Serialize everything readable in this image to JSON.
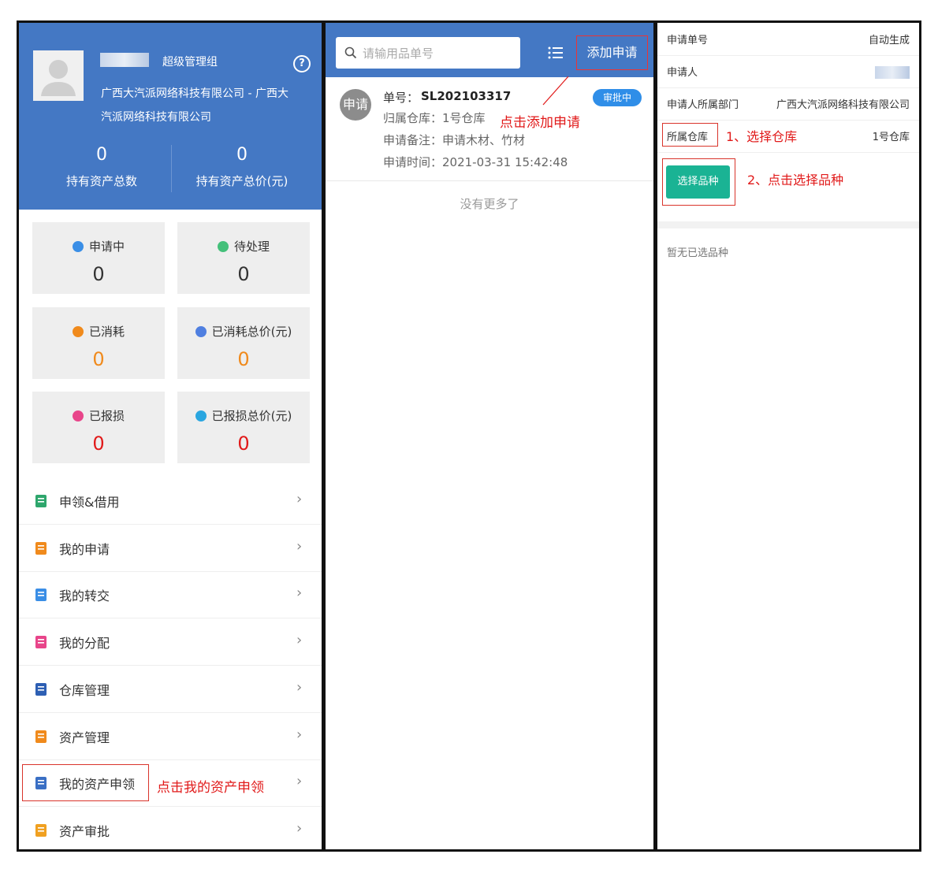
{
  "panel1": {
    "user_group": "超级管理组",
    "company": "广西大汽派网络科技有限公司 - 广西大汽派网络科技有限公司",
    "company_line1": "广西大汽派网络科技有限公司 - 广西大",
    "company_line2": "汽派网络科技有限公司",
    "help_icon": "?",
    "stats": [
      {
        "value": "0",
        "label": "持有资产总数"
      },
      {
        "value": "0",
        "label": "持有资产总价(元)"
      }
    ],
    "cards": [
      {
        "label": "申请中",
        "value": "0",
        "icon": "keyboard-icon",
        "color": "#333333",
        "icon_color": "#3a8ee6"
      },
      {
        "label": "待处理",
        "value": "0",
        "icon": "user-clock-icon",
        "color": "#333333",
        "icon_color": "#44c07a"
      },
      {
        "label": "已消耗",
        "value": "0",
        "icon": "search-circle-icon",
        "color": "#f08a1c",
        "icon_color": "#f08a1c"
      },
      {
        "label": "已消耗总价(元)",
        "value": "0",
        "icon": "money-bag-icon",
        "color": "#f08a1c",
        "icon_color": "#4f7fe0"
      },
      {
        "label": "已报损",
        "value": "0",
        "icon": "broken-icon",
        "color": "#e11a1a",
        "icon_color": "#e8458a"
      },
      {
        "label": "已报损总价(元)",
        "value": "0",
        "icon": "coins-icon",
        "color": "#e11a1a",
        "icon_color": "#2aa6e0"
      }
    ],
    "menu": [
      {
        "label": "申领&借用",
        "icon": "people-flow-icon"
      },
      {
        "label": "我的申请",
        "icon": "document-icon"
      },
      {
        "label": "我的转交",
        "icon": "user-transfer-icon"
      },
      {
        "label": "我的分配",
        "icon": "org-chart-icon"
      },
      {
        "label": "仓库管理",
        "icon": "warehouse-icon"
      },
      {
        "label": "资产管理",
        "icon": "wheelbarrow-icon"
      },
      {
        "label": "我的资产申领",
        "icon": "monitor-upload-icon"
      },
      {
        "label": "资产审批",
        "icon": "approval-doc-icon"
      }
    ],
    "annotation": "点击我的资产申领"
  },
  "panel2": {
    "search_placeholder": "请输用品单号",
    "add_button": "添加申请",
    "annotation": "点击添加申请",
    "item": {
      "avatar_text": "申请",
      "number_label": "单号：",
      "number": "SL202103317",
      "warehouse": "归属仓库：1号仓库",
      "remark": "申请备注：申请木材、竹材",
      "time": "申请时间：2021-03-31 15:42:48",
      "status": "审批中"
    },
    "no_more": "没有更多了"
  },
  "panel3": {
    "rows": [
      {
        "label": "申请单号",
        "value": "自动生成"
      },
      {
        "label": "申请人",
        "value": ""
      },
      {
        "label": "申请人所属部门",
        "value": "广西大汽派网络科技有限公司"
      },
      {
        "label": "所属仓库",
        "value": "1号仓库"
      }
    ],
    "annotation1": "1、选择仓库",
    "select_button": "选择品种",
    "annotation2": "2、点击选择品种",
    "empty_text": "暂无已选品种"
  }
}
